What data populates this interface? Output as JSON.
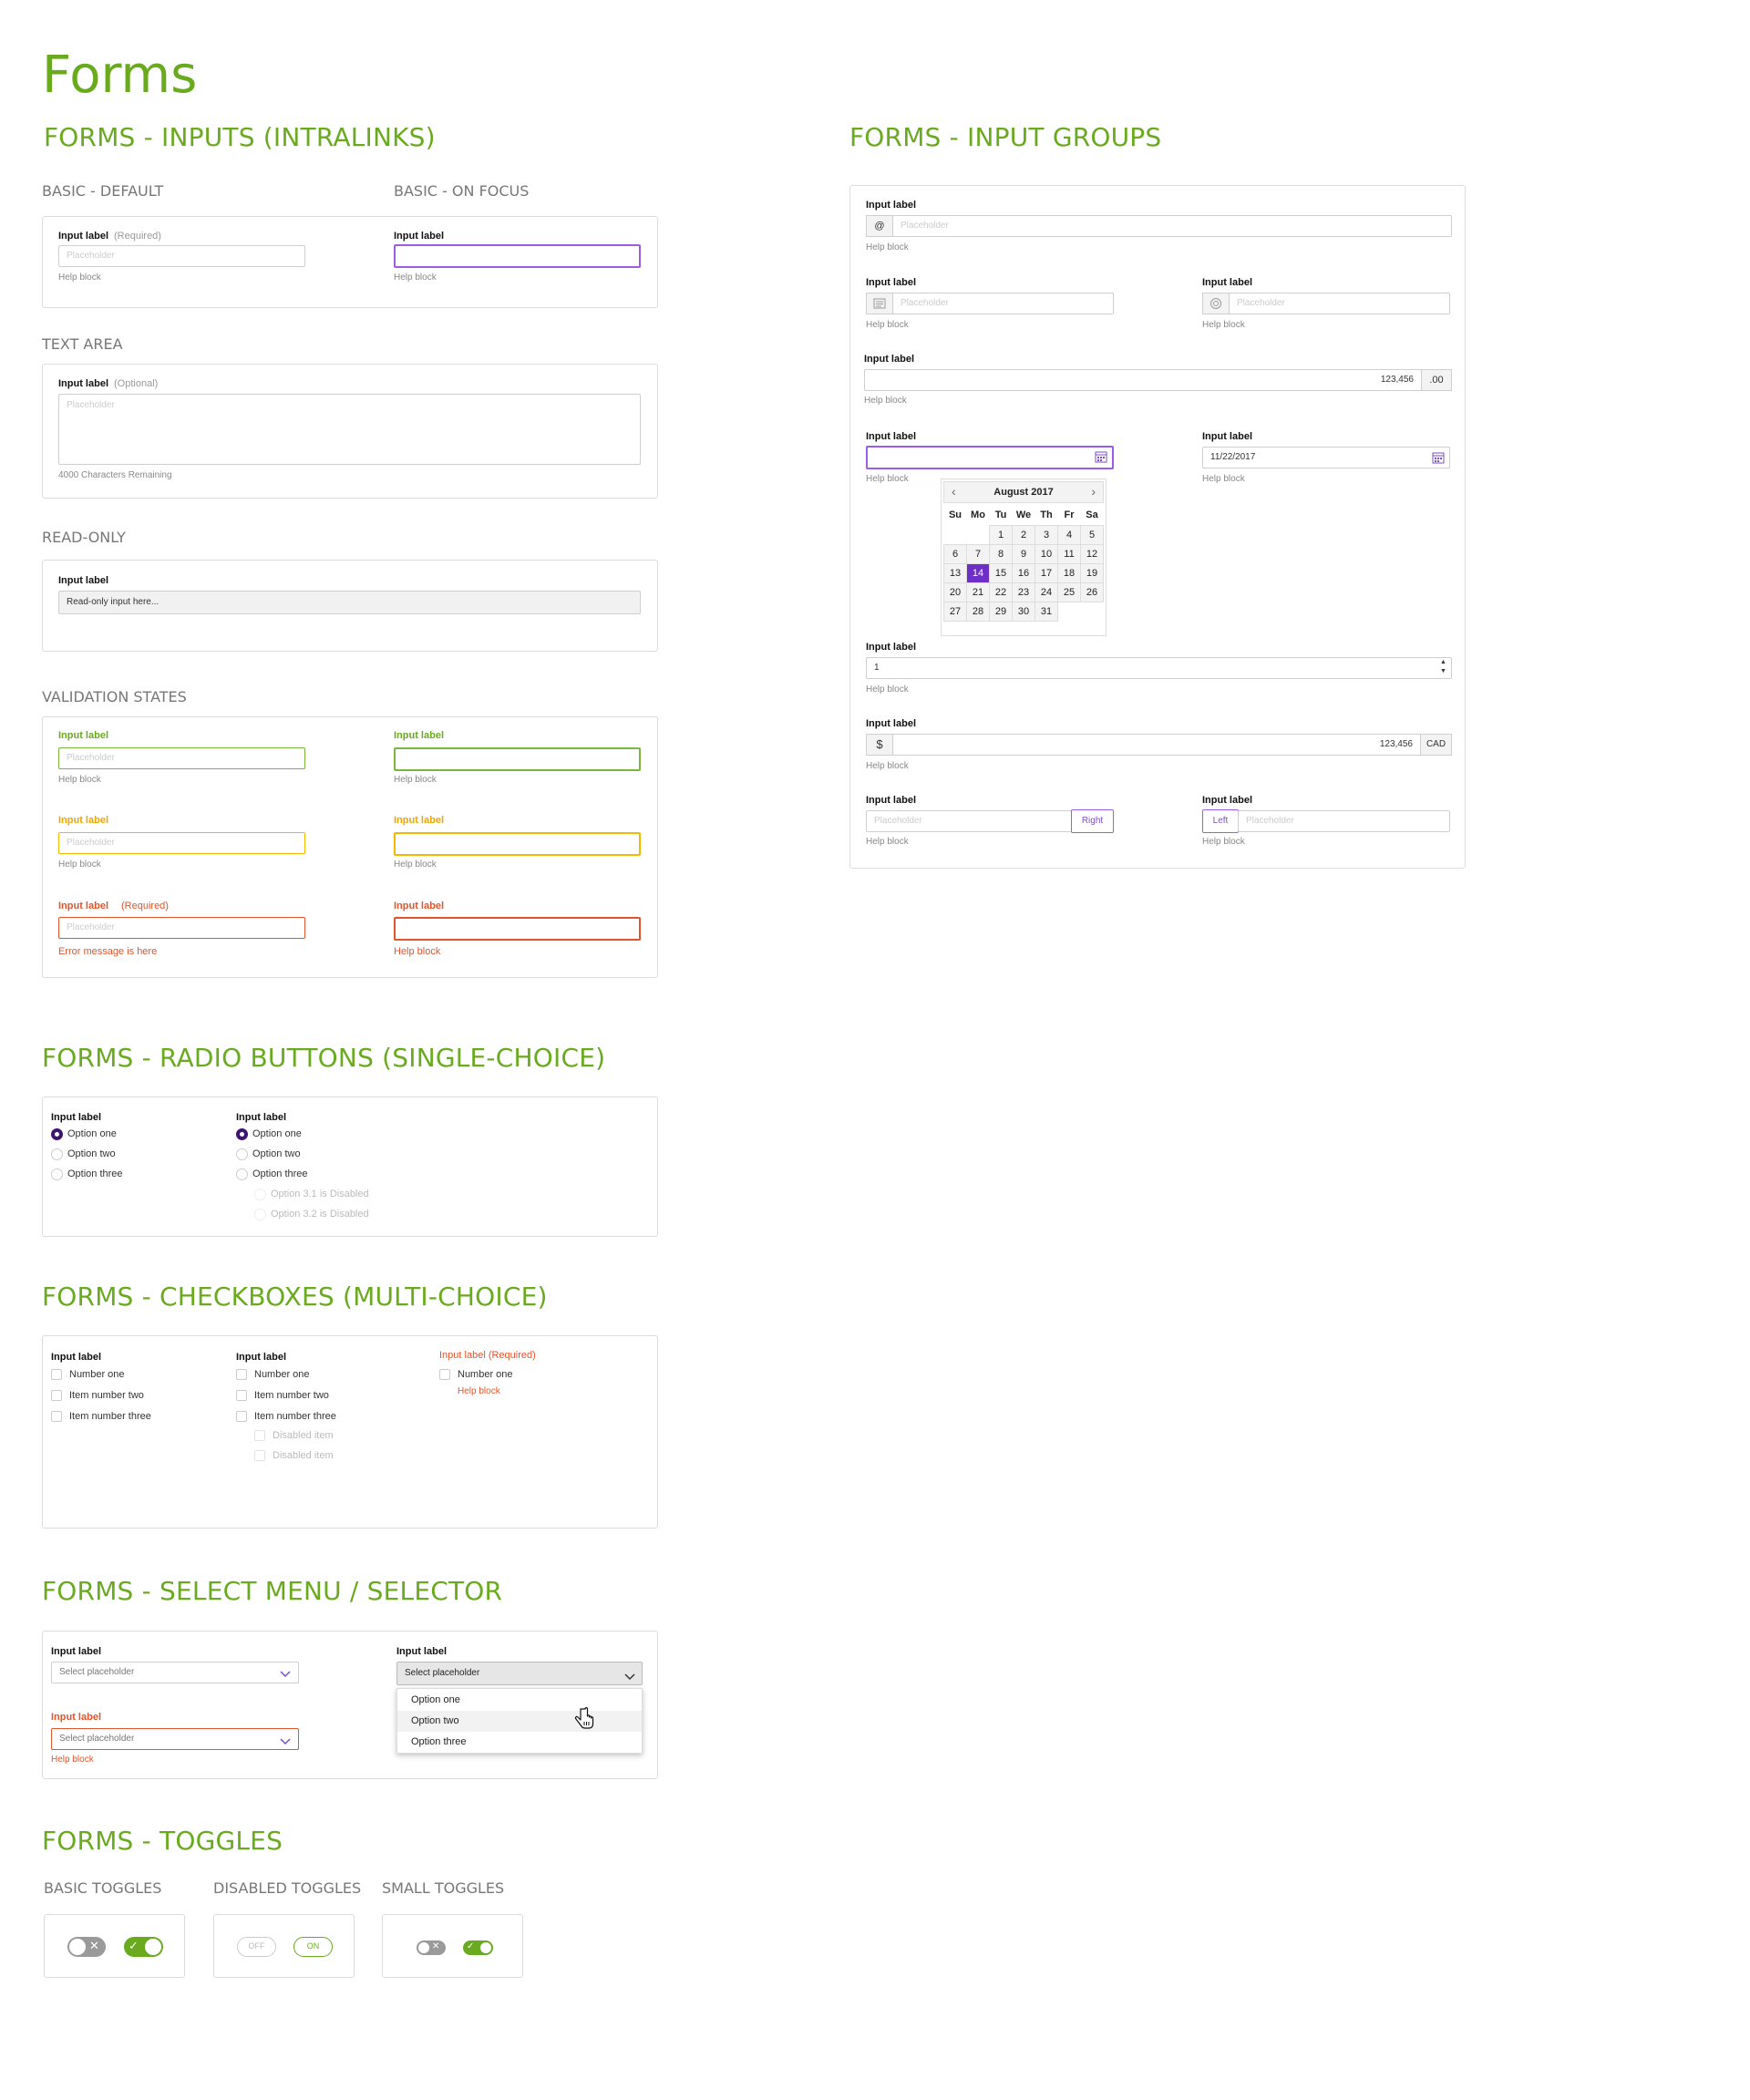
{
  "page_title": "Forms",
  "sections": {
    "inputs": "FORMS - INPUTS (INTRALINKS)",
    "input_groups": "FORMS - INPUT GROUPS",
    "radio": "FORMS - RADIO BUTTONS (SINGLE-CHOICE)",
    "checkbox": "FORMS - CHECKBOXES (MULTI-CHOICE)",
    "select": "FORMS - SELECT MENU / SELECTOR",
    "toggles": "FORMS - TOGGLES"
  },
  "subs": {
    "basic_default": "BASIC - DEFAULT",
    "basic_focus": "BASIC - ON FOCUS",
    "text_area": "TEXT AREA",
    "read_only": "READ-ONLY",
    "validation": "VALIDATION STATES",
    "basic_toggles": "BASIC TOGGLES",
    "disabled_toggles": "DISABLED TOGGLES",
    "small_toggles": "SMALL TOGGLES"
  },
  "common": {
    "input_label": "Input label",
    "placeholder": "Placeholder",
    "help_block": "Help block",
    "required": "(Required)",
    "optional": "(Optional)"
  },
  "textarea": {
    "remaining": "4000 Characters Remaining"
  },
  "readonly": {
    "value": "Read-only input here..."
  },
  "validation": {
    "error_message": "Error message is here"
  },
  "input_groups": {
    "at": "@",
    "number_value": "123,456",
    "decimal": ".00",
    "date_value": "11/22/2017",
    "calendar_month": "August 2017",
    "calendar_days": [
      "Su",
      "Mo",
      "Tu",
      "We",
      "Th",
      "Fr",
      "Sa"
    ],
    "calendar_weeks": [
      [
        "",
        "",
        "1",
        "2",
        "3",
        "4",
        "5"
      ],
      [
        "6",
        "7",
        "8",
        "9",
        "10",
        "11",
        "12"
      ],
      [
        "13",
        "14",
        "15",
        "16",
        "17",
        "18",
        "19"
      ],
      [
        "20",
        "21",
        "22",
        "23",
        "24",
        "25",
        "26"
      ],
      [
        "27",
        "28",
        "29",
        "30",
        "31",
        "",
        ""
      ]
    ],
    "selected_day": "14",
    "stepper_value": "1",
    "currency_symbol": "$",
    "currency_value": "123,456",
    "currency_code": "CAD",
    "right_btn": "Right",
    "left_btn": "Left"
  },
  "radio": {
    "col1": [
      "Option one",
      "Option two",
      "Option three"
    ],
    "col2": [
      "Option one",
      "Option two",
      "Option three"
    ],
    "col2_disabled": [
      "Option 3.1 is Disabled",
      "Option 3.2 is Disabled"
    ]
  },
  "checkbox": {
    "col1": [
      "Number one",
      "Item number two",
      "Item number three"
    ],
    "col2": [
      "Number one",
      "Item number two",
      "Item number three"
    ],
    "col2_disabled": [
      "Disabled item",
      "Disabled item"
    ],
    "col3": [
      "Number one"
    ]
  },
  "select": {
    "placeholder": "Select placeholder",
    "options": [
      "Option one",
      "Option two",
      "Option three"
    ]
  },
  "toggles": {
    "off": "OFF",
    "on": "ON"
  },
  "colors": {
    "brand_green": "#6aaa1f",
    "focus_purple": "#9b5de5",
    "error": "#e2542b",
    "warning": "#f5b800"
  }
}
